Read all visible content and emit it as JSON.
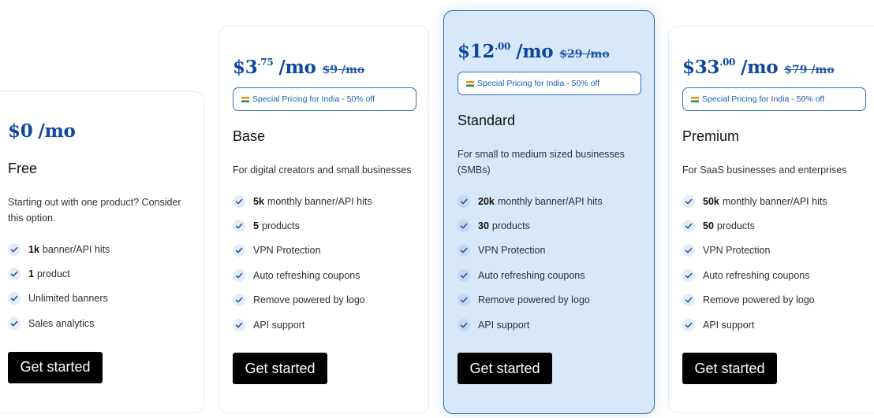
{
  "colors": {
    "accent": "#0d47a1",
    "promo_border": "#2f6db5",
    "highlight_bg": "#d8e8fb",
    "button_bg": "#000000",
    "button_text": "#ffffff"
  },
  "plans": [
    {
      "name": "Free",
      "price_main": "$0",
      "price_cents": "",
      "price_period": "/mo",
      "old_price": "",
      "promo": "",
      "description": "Starting out with one product? Consider this option.",
      "features": [
        {
          "bold": "1k",
          "text": "banner/API hits"
        },
        {
          "bold": "1",
          "text": "product"
        },
        {
          "bold": "",
          "text": "Unlimited banners"
        },
        {
          "bold": "",
          "text": "Sales analytics"
        }
      ],
      "cta": "Get started",
      "highlighted": false
    },
    {
      "name": "Base",
      "price_main": "$3",
      "price_cents": ".75",
      "price_period": "/mo",
      "old_price": "$9 /mo",
      "promo": "Special Pricing for India - 50% off",
      "description": "For digital creators and small businesses",
      "features": [
        {
          "bold": "5k",
          "text": "monthly banner/API hits"
        },
        {
          "bold": "5",
          "text": "products"
        },
        {
          "bold": "",
          "text": "VPN Protection"
        },
        {
          "bold": "",
          "text": "Auto refreshing coupons"
        },
        {
          "bold": "",
          "text": "Remove powered by logo"
        },
        {
          "bold": "",
          "text": "API support"
        }
      ],
      "cta": "Get started",
      "highlighted": false
    },
    {
      "name": "Standard",
      "price_main": "$12",
      "price_cents": ".00",
      "price_period": "/mo",
      "old_price": "$29 /mo",
      "promo": "Special Pricing for India - 50% off",
      "description": "For small to medium sized businesses (SMBs)",
      "features": [
        {
          "bold": "20k",
          "text": "monthly banner/API hits"
        },
        {
          "bold": "30",
          "text": "products"
        },
        {
          "bold": "",
          "text": "VPN Protection"
        },
        {
          "bold": "",
          "text": "Auto refreshing coupons"
        },
        {
          "bold": "",
          "text": "Remove powered by logo"
        },
        {
          "bold": "",
          "text": "API support"
        }
      ],
      "cta": "Get started",
      "highlighted": true
    },
    {
      "name": "Premium",
      "price_main": "$33",
      "price_cents": ".00",
      "price_period": "/mo",
      "old_price": "$79 /mo",
      "promo": "Special Pricing for India - 50% off",
      "description": "For SaaS businesses and enterprises",
      "features": [
        {
          "bold": "50k",
          "text": "monthly banner/API hits"
        },
        {
          "bold": "50",
          "text": "products"
        },
        {
          "bold": "",
          "text": "VPN Protection"
        },
        {
          "bold": "",
          "text": "Auto refreshing coupons"
        },
        {
          "bold": "",
          "text": "Remove powered by logo"
        },
        {
          "bold": "",
          "text": "API support"
        }
      ],
      "cta": "Get started",
      "highlighted": false
    }
  ]
}
